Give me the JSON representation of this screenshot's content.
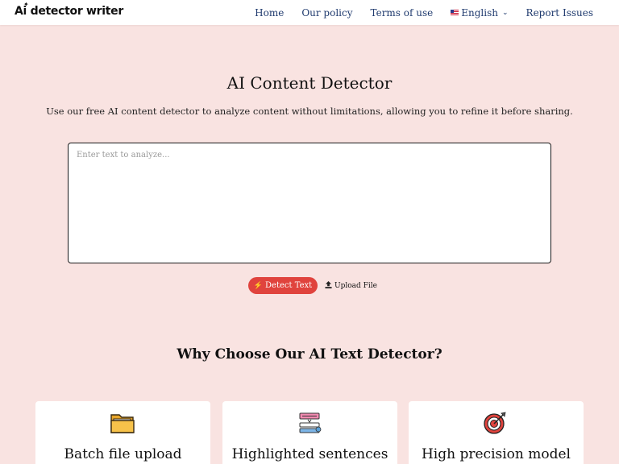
{
  "header": {
    "logo_text": "Ai detector writer",
    "nav": [
      {
        "label": "Home"
      },
      {
        "label": "Our policy"
      },
      {
        "label": "Terms of use"
      },
      {
        "label": "English"
      },
      {
        "label": "Report Issues"
      }
    ]
  },
  "main": {
    "title": "AI Content Detector",
    "subtitle": "Use our free AI content detector to analyze content without limitations, allowing you to refine it before sharing.",
    "input_placeholder": "Enter text to analyze...",
    "detect_label": "Detect Text",
    "upload_label": "Upload File"
  },
  "features": {
    "title": "Why Choose Our AI Text Detector?",
    "cards": [
      {
        "title": "Batch file upload",
        "icon": "folder-icon"
      },
      {
        "title": "Highlighted sentences",
        "icon": "highlight-icon"
      },
      {
        "title": "High precision model",
        "icon": "target-icon"
      }
    ]
  },
  "colors": {
    "background": "#f9e3e1",
    "accent": "#e0433d",
    "nav_text": "#1f3a6e"
  }
}
